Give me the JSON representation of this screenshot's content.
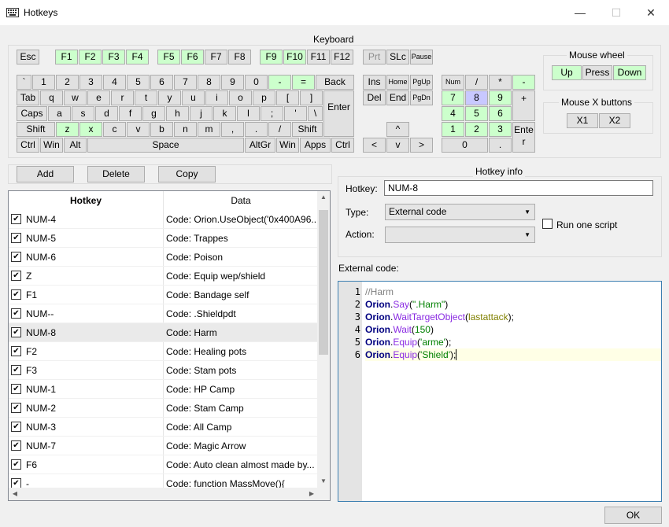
{
  "window": {
    "title": "Hotkeys",
    "minimize": "—",
    "maximize": "☐",
    "close": "✕"
  },
  "keyboard": {
    "label": "Keyboard",
    "keys": [
      {
        "label": "Esc"
      },
      {
        "label": "F1",
        "state": "green"
      },
      {
        "label": "F2",
        "state": "green"
      },
      {
        "label": "F3",
        "state": "green"
      },
      {
        "label": "F4",
        "state": "green"
      },
      {
        "label": "F5",
        "state": "green"
      },
      {
        "label": "F6",
        "state": "green"
      },
      {
        "label": "F7"
      },
      {
        "label": "F8"
      },
      {
        "label": "F9",
        "state": "green"
      },
      {
        "label": "F10",
        "state": "green"
      },
      {
        "label": "F11"
      },
      {
        "label": "F12"
      },
      {
        "label": "Prt",
        "state": "disabled"
      },
      {
        "label": "SLc"
      },
      {
        "label": "Pause"
      },
      {
        "label": "`"
      },
      {
        "label": "1"
      },
      {
        "label": "2"
      },
      {
        "label": "3"
      },
      {
        "label": "4"
      },
      {
        "label": "5"
      },
      {
        "label": "6"
      },
      {
        "label": "7"
      },
      {
        "label": "8"
      },
      {
        "label": "9"
      },
      {
        "label": "0"
      },
      {
        "label": "-",
        "state": "green"
      },
      {
        "label": "=",
        "state": "green"
      },
      {
        "label": "Back"
      },
      {
        "label": "Tab"
      },
      {
        "label": "q"
      },
      {
        "label": "w"
      },
      {
        "label": "e"
      },
      {
        "label": "r"
      },
      {
        "label": "t"
      },
      {
        "label": "y"
      },
      {
        "label": "u"
      },
      {
        "label": "i"
      },
      {
        "label": "o"
      },
      {
        "label": "p"
      },
      {
        "label": "["
      },
      {
        "label": "]"
      },
      {
        "label": "Enter"
      },
      {
        "label": "Caps"
      },
      {
        "label": "a"
      },
      {
        "label": "s"
      },
      {
        "label": "d"
      },
      {
        "label": "f"
      },
      {
        "label": "g"
      },
      {
        "label": "h"
      },
      {
        "label": "j"
      },
      {
        "label": "k"
      },
      {
        "label": "l"
      },
      {
        "label": ";"
      },
      {
        "label": "'"
      },
      {
        "label": "\\"
      },
      {
        "label": "Shift"
      },
      {
        "label": "z",
        "state": "green"
      },
      {
        "label": "x",
        "state": "green"
      },
      {
        "label": "c"
      },
      {
        "label": "v"
      },
      {
        "label": "b"
      },
      {
        "label": "n"
      },
      {
        "label": "m"
      },
      {
        "label": ","
      },
      {
        "label": "."
      },
      {
        "label": "/"
      },
      {
        "label": "Shift"
      },
      {
        "label": "Ctrl"
      },
      {
        "label": "Win"
      },
      {
        "label": "Alt"
      },
      {
        "label": "Space"
      },
      {
        "label": "AltGr"
      },
      {
        "label": "Win"
      },
      {
        "label": "Apps"
      },
      {
        "label": "Ctrl"
      },
      {
        "label": "Ins"
      },
      {
        "label": "Home"
      },
      {
        "label": "PgUp"
      },
      {
        "label": "Del"
      },
      {
        "label": "End"
      },
      {
        "label": "PgDn"
      },
      {
        "label": "^"
      },
      {
        "label": "<"
      },
      {
        "label": "v"
      },
      {
        "label": ">"
      },
      {
        "label": "Num"
      },
      {
        "label": "/"
      },
      {
        "label": "*"
      },
      {
        "label": "-",
        "state": "green"
      },
      {
        "label": "7",
        "state": "green"
      },
      {
        "label": "8",
        "state": "blue"
      },
      {
        "label": "9",
        "state": "green"
      },
      {
        "label": "+"
      },
      {
        "label": "4",
        "state": "green"
      },
      {
        "label": "5",
        "state": "green"
      },
      {
        "label": "6",
        "state": "green"
      },
      {
        "label": "1",
        "state": "green"
      },
      {
        "label": "2",
        "state": "green"
      },
      {
        "label": "3",
        "state": "green"
      },
      {
        "label": "Enter"
      },
      {
        "label": "0"
      },
      {
        "label": "."
      }
    ]
  },
  "mouse_wheel": {
    "label": "Mouse wheel",
    "up": "Up",
    "press": "Press",
    "down": "Down"
  },
  "mouse_x": {
    "label": "Mouse X buttons",
    "x1": "X1",
    "x2": "X2"
  },
  "toolbar": {
    "add": "Add",
    "delete": "Delete",
    "copy": "Copy"
  },
  "list": {
    "col_hotkey": "Hotkey",
    "col_data": "Data",
    "rows": [
      {
        "hotkey": "NUM-4",
        "data": "Code: Orion.UseObject('0x400A96...",
        "checked": true
      },
      {
        "hotkey": "NUM-5",
        "data": "Code: Trappes",
        "checked": true
      },
      {
        "hotkey": "NUM-6",
        "data": "Code:  Poison",
        "checked": true
      },
      {
        "hotkey": "Z",
        "data": "Code: Equip wep/shield",
        "checked": true
      },
      {
        "hotkey": "F1",
        "data": "Code: Bandage self",
        "checked": true
      },
      {
        "hotkey": "NUM--",
        "data": "Code: .Shieldpdt",
        "checked": true
      },
      {
        "hotkey": "NUM-8",
        "data": "Code: Harm",
        "checked": true,
        "selected": true
      },
      {
        "hotkey": "F2",
        "data": "Code: Healing pots",
        "checked": true
      },
      {
        "hotkey": "F3",
        "data": "Code: Stam pots",
        "checked": true
      },
      {
        "hotkey": "NUM-1",
        "data": "Code: HP Camp",
        "checked": true
      },
      {
        "hotkey": "NUM-2",
        "data": "Code: Stam Camp",
        "checked": true
      },
      {
        "hotkey": "NUM-3",
        "data": "Code: All Camp",
        "checked": true
      },
      {
        "hotkey": "NUM-7",
        "data": "Code:  Magic Arrow",
        "checked": true
      },
      {
        "hotkey": "F6",
        "data": "Code: Auto clean almost made by...",
        "checked": true
      },
      {
        "hotkey": "-",
        "data": "Code: function MassMove(){",
        "checked": true
      }
    ]
  },
  "hotkey_info": {
    "label": "Hotkey info",
    "hotkey_label": "Hotkey:",
    "hotkey_value": "NUM-8",
    "type_label": "Type:",
    "type_value": "External code",
    "action_label": "Action:",
    "action_value": "",
    "run_one_script": "Run one script"
  },
  "external_code": {
    "label": "External code:",
    "line_numbers": [
      "1",
      "2",
      "3",
      "4",
      "5",
      "6"
    ]
  },
  "ok_button": "OK"
}
